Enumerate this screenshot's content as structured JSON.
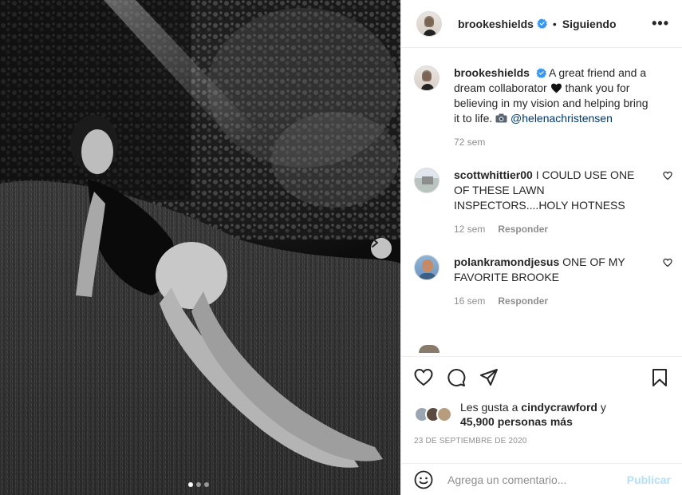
{
  "colors": {
    "accent": "#0095f6",
    "verified": "#3897f0",
    "link": "#00376b",
    "muted": "#8e8e8e"
  },
  "header": {
    "username": "brookeshields",
    "separator": "•",
    "follow_label": "Siguiendo",
    "more_label": "•••"
  },
  "caption": {
    "username": "brookeshields",
    "text": "A great friend and a dream collaborator",
    "heart_icon": "black-heart",
    "text2": "thank you for believing in my vision and helping bring it to life.",
    "camera_icon": "camera",
    "mention": "@helenachristensen",
    "time": "72 sem"
  },
  "comments": [
    {
      "username": "scottwhittier00",
      "text": "I COULD USE ONE OF THESE LAWN INSPECTORS....HOLY HOTNESS",
      "time": "12 sem",
      "reply": "Responder"
    },
    {
      "username": "polankramondjesus",
      "text": "ONE OF MY FAVORITE BROOKE",
      "time": "16 sem",
      "reply": "Responder"
    }
  ],
  "likes": {
    "prefix": "Les gusta a",
    "user": "cindycrawford",
    "conj": "y",
    "count": "45,900 personas más"
  },
  "date": "23 DE SEPTIEMBRE DE 2020",
  "add_comment": {
    "placeholder": "Agrega un comentario...",
    "publish": "Publicar"
  },
  "carousel": {
    "current": 1,
    "total": 3
  }
}
